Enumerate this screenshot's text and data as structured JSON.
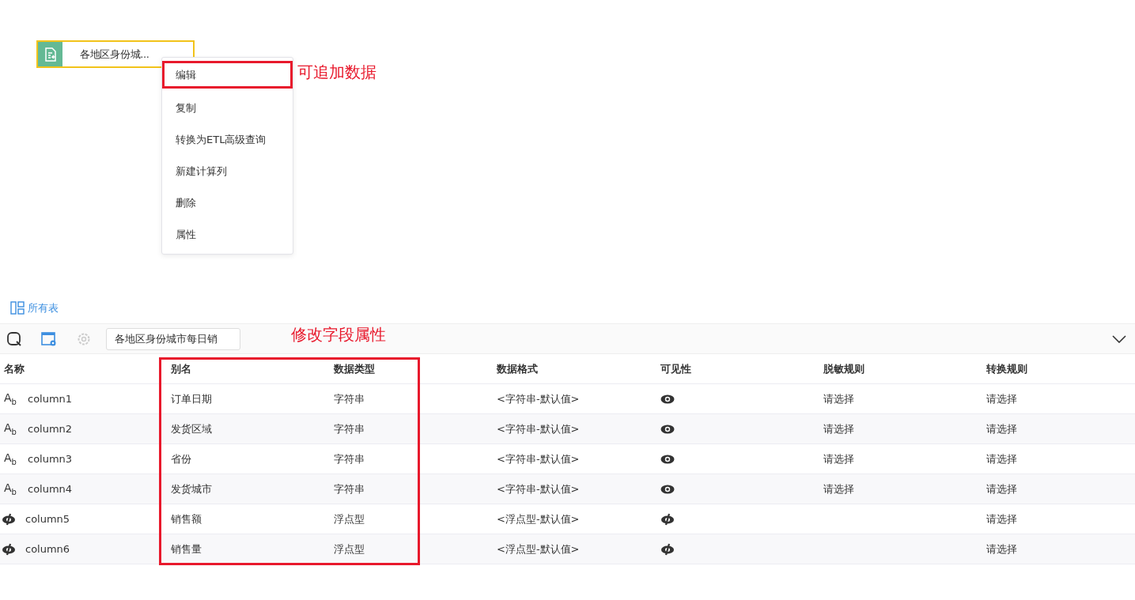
{
  "canvas": {
    "node": {
      "title": "各地区身份城..."
    },
    "context_menu": [
      {
        "label": "编辑",
        "highlighted": true
      },
      {
        "label": "复制",
        "highlighted": false
      },
      {
        "label": "转换为ETL高级查询",
        "highlighted": false
      },
      {
        "label": "新建计算列",
        "highlighted": false
      },
      {
        "label": "删除",
        "highlighted": false
      },
      {
        "label": "属性",
        "highlighted": false
      }
    ]
  },
  "annotations": {
    "menu_note": "可追加数据",
    "table_note": "修改字段属性"
  },
  "all_tables_link": "所有表",
  "toolbar": {
    "table_name": "各地区身份城市每日销"
  },
  "table": {
    "columns": [
      "名称",
      "别名",
      "数据类型",
      "数据格式",
      "可见性",
      "脱敏规则",
      "转换规则"
    ],
    "rows": [
      {
        "kind": "string",
        "type_mark": "A$_{b}$",
        "name": "column1",
        "alias": "订单日期",
        "data_type": "字符串",
        "format": "<字符串-默认值>",
        "visible": true,
        "mask_rule": "请选择",
        "convert_rule": "请选择"
      },
      {
        "kind": "string",
        "type_mark": "A$_{b}$",
        "name": "column2",
        "alias": "发货区域",
        "data_type": "字符串",
        "format": "<字符串-默认值>",
        "visible": true,
        "mask_rule": "请选择",
        "convert_rule": "请选择"
      },
      {
        "kind": "string",
        "type_mark": "A$_{b}$",
        "name": "column3",
        "alias": "省份",
        "data_type": "字符串",
        "format": "<字符串-默认值>",
        "visible": true,
        "mask_rule": "请选择",
        "convert_rule": "请选择"
      },
      {
        "kind": "string",
        "type_mark": "A$_{b}$",
        "name": "column4",
        "alias": "发货城市",
        "data_type": "字符串",
        "format": "<字符串-默认值>",
        "visible": true,
        "mask_rule": "请选择",
        "convert_rule": "请选择"
      },
      {
        "kind": "float",
        "name": "column5",
        "alias": "销售额",
        "data_type": "浮点型",
        "format": "<浮点型-默认值>",
        "visible": false,
        "convert_rule": "请选择"
      },
      {
        "kind": "float",
        "name": "column6",
        "alias": "销售量",
        "data_type": "浮点型",
        "format": "<浮点型-默认值>",
        "visible": false,
        "convert_rule": "请选择"
      }
    ]
  }
}
